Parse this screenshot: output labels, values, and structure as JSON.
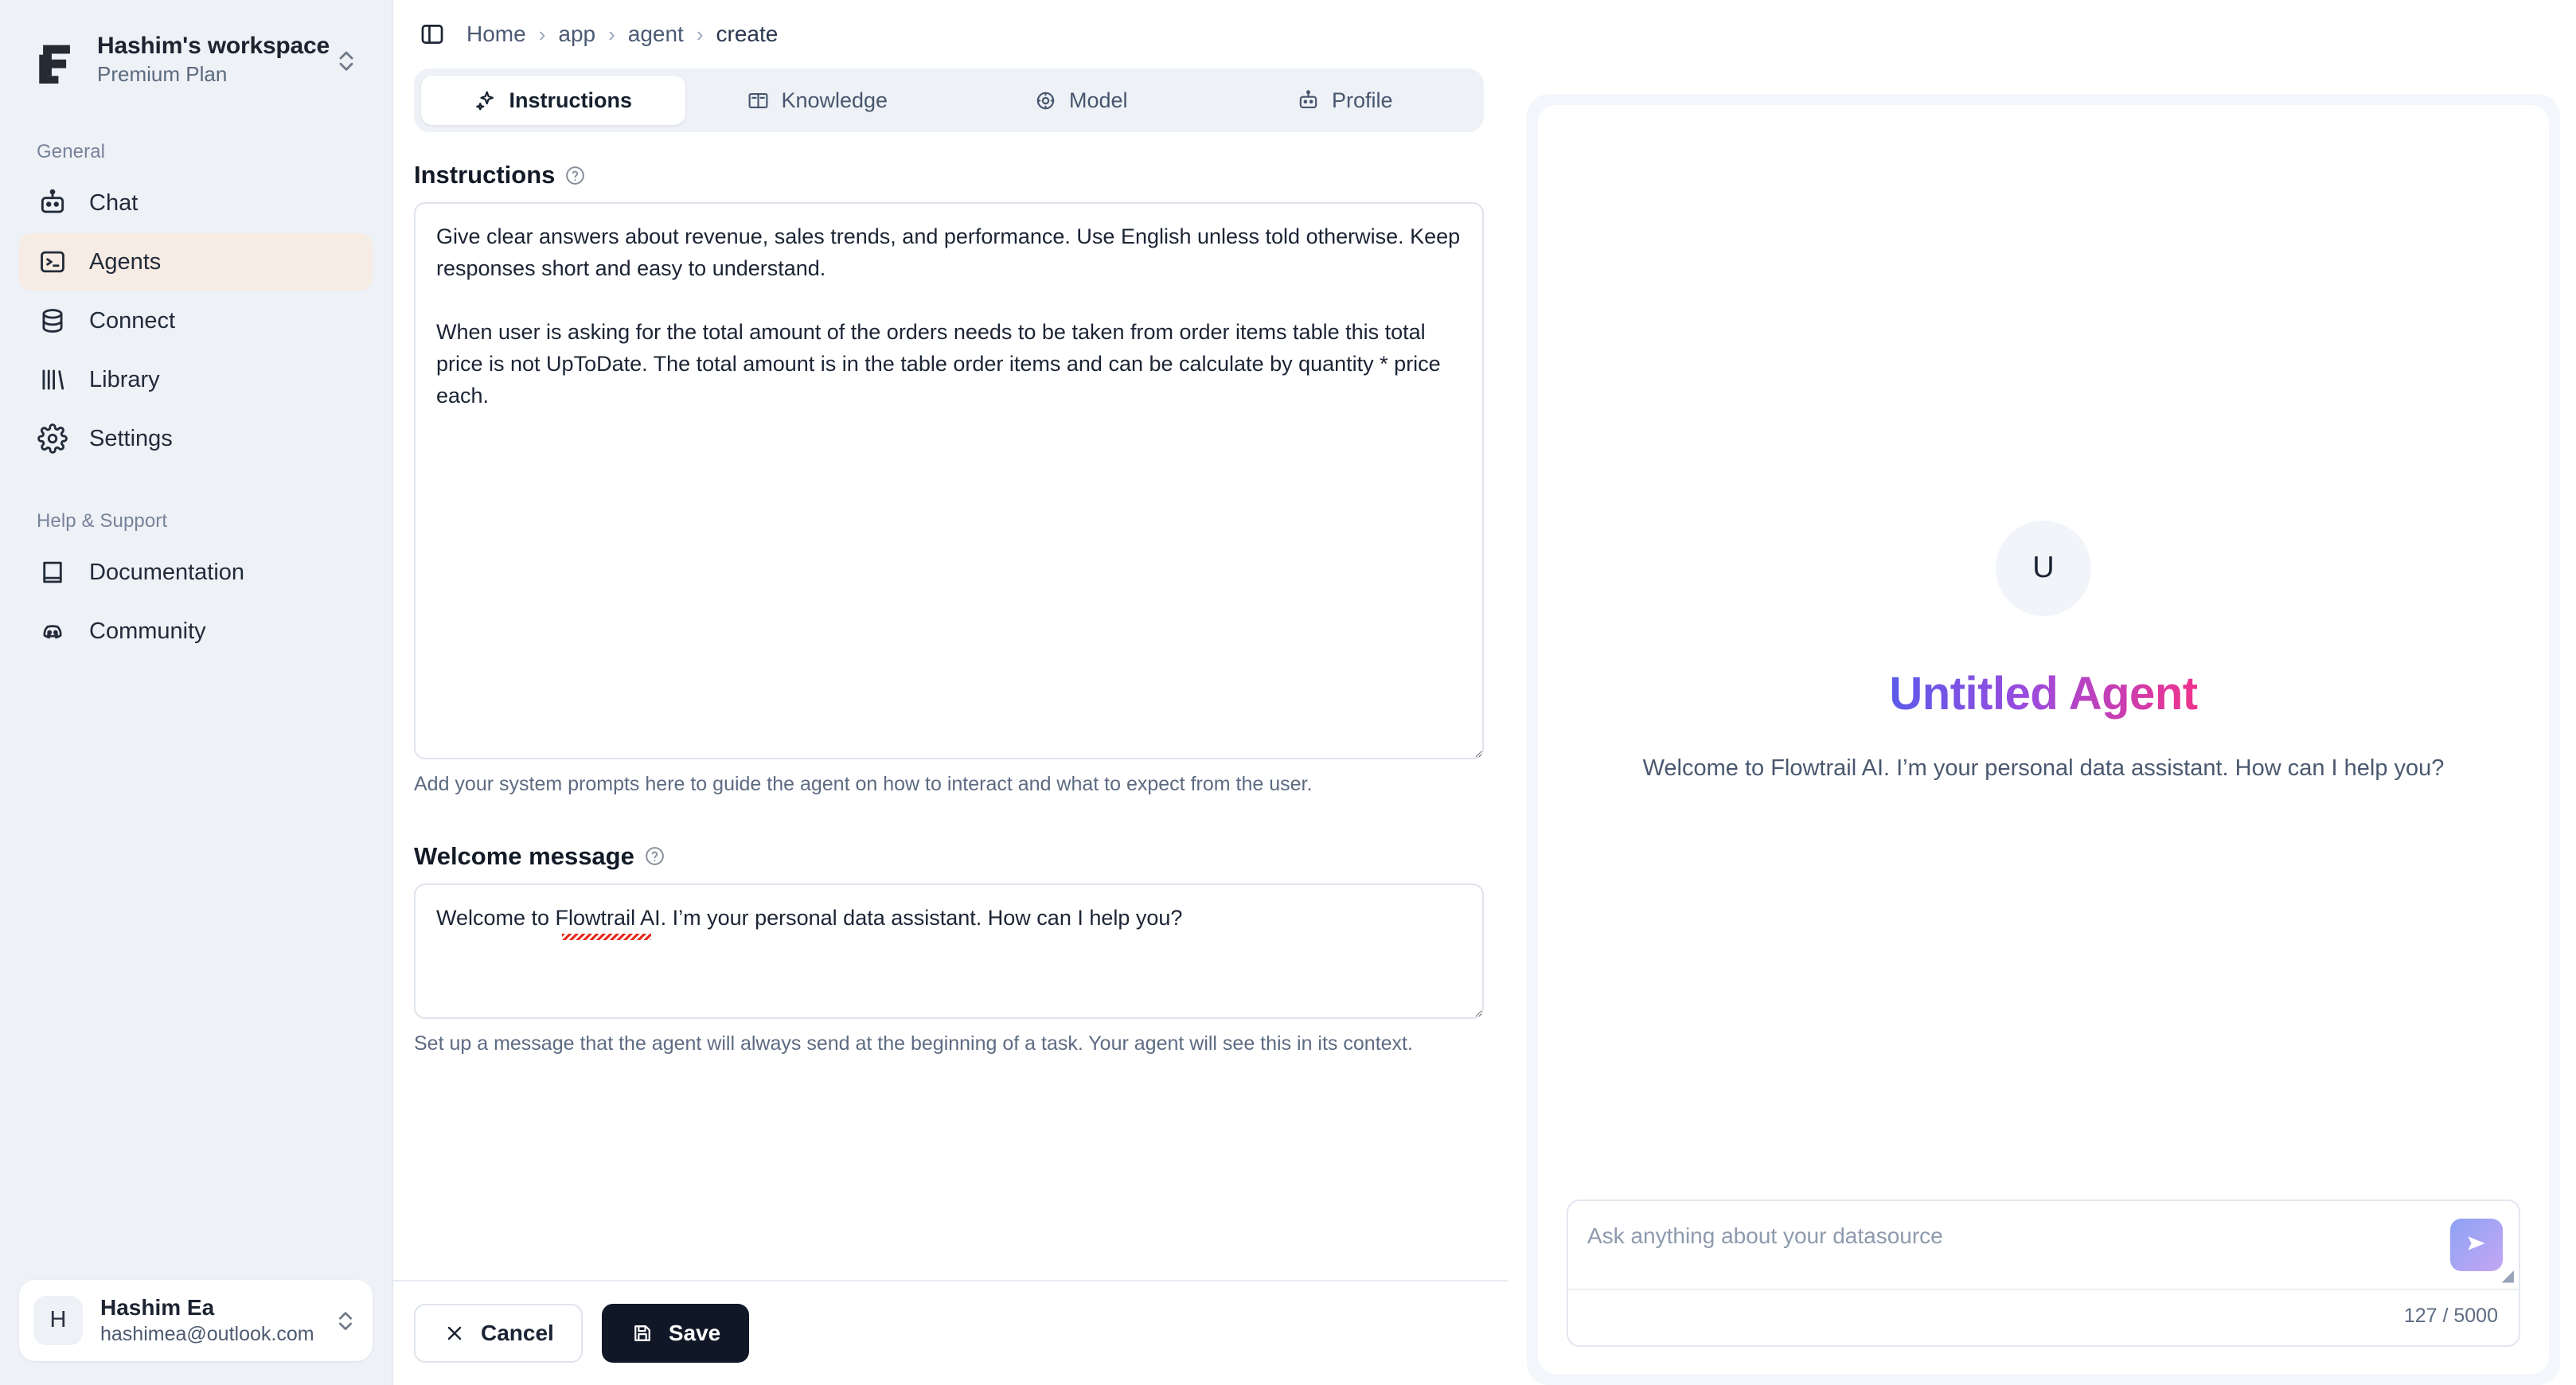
{
  "sidebar": {
    "workspace": {
      "name": "Hashim's workspace",
      "plan": "Premium Plan",
      "logo_icon": "flowtrail-logo-icon",
      "switcher_icon": "chevron-up-down-icon"
    },
    "sections": [
      {
        "label": "General",
        "items": [
          {
            "label": "Chat",
            "icon": "bot-icon",
            "active": false
          },
          {
            "label": "Agents",
            "icon": "terminal-square-icon",
            "active": true
          },
          {
            "label": "Connect",
            "icon": "database-icon",
            "active": false
          },
          {
            "label": "Library",
            "icon": "books-icon",
            "active": false
          },
          {
            "label": "Settings",
            "icon": "gear-icon",
            "active": false
          }
        ]
      },
      {
        "label": "Help & Support",
        "items": [
          {
            "label": "Documentation",
            "icon": "book-icon",
            "active": false
          },
          {
            "label": "Community",
            "icon": "discord-icon",
            "active": false
          }
        ]
      }
    ],
    "user": {
      "initial": "H",
      "name": "Hashim Ea",
      "email": "hashimea@outlook.com",
      "switcher_icon": "chevron-up-down-icon"
    }
  },
  "topbar": {
    "panel_toggle_icon": "sidebar-panel-icon",
    "breadcrumb": [
      "Home",
      "app",
      "agent",
      "create"
    ],
    "separator": "›"
  },
  "tabs": [
    {
      "label": "Instructions",
      "icon": "sparkles-icon",
      "active": true
    },
    {
      "label": "Knowledge",
      "icon": "open-book-icon",
      "active": false
    },
    {
      "label": "Model",
      "icon": "brain-cog-icon",
      "active": false
    },
    {
      "label": "Profile",
      "icon": "bot-icon",
      "active": false
    }
  ],
  "form": {
    "instructions": {
      "title": "Instructions",
      "help_icon": "question-circle-icon",
      "value": "Give clear answers about revenue, sales trends, and performance. Use English unless told otherwise. Keep responses short and easy to understand.\n\nWhen user is asking for the total amount of the orders needs to be taken from order items table this total price is not UpToDate. The total amount is in the table order items and can be calculate by quantity * price each.",
      "hint": "Add your system prompts here to guide the agent on how to interact and what to expect from the user."
    },
    "welcome": {
      "title": "Welcome message",
      "help_icon": "question-circle-icon",
      "value": "Welcome to Flowtrail AI. I’m your personal data assistant. How can I help you?",
      "hint": "Set up a message that the agent will always send at the beginning of a task. Your agent will see this in its context."
    }
  },
  "footer": {
    "cancel_label": "Cancel",
    "cancel_icon": "close-x-icon",
    "save_label": "Save",
    "save_icon": "floppy-disk-icon"
  },
  "preview": {
    "avatar_initial": "U",
    "agent_title": "Untitled Agent",
    "welcome_text": "Welcome to Flowtrail AI. I’m your personal data assistant. How can I help you?",
    "input_placeholder": "Ask anything about your datasource",
    "input_value": "",
    "send_icon": "send-arrow-icon",
    "counter": "127 / 5000"
  },
  "colors": {
    "sidebar_bg": "#eef1f6",
    "active_nav_bg": "#f7ece3",
    "save_btn_bg": "#101828",
    "title_gradient_start": "#5b5bea",
    "title_gradient_mid": "#9b4bdd",
    "title_gradient_end": "#f0328c",
    "send_btn_gradient_start": "#8da2f5",
    "send_btn_gradient_end": "#c4a7f3",
    "spellcheck_underline": "#e8291d"
  }
}
